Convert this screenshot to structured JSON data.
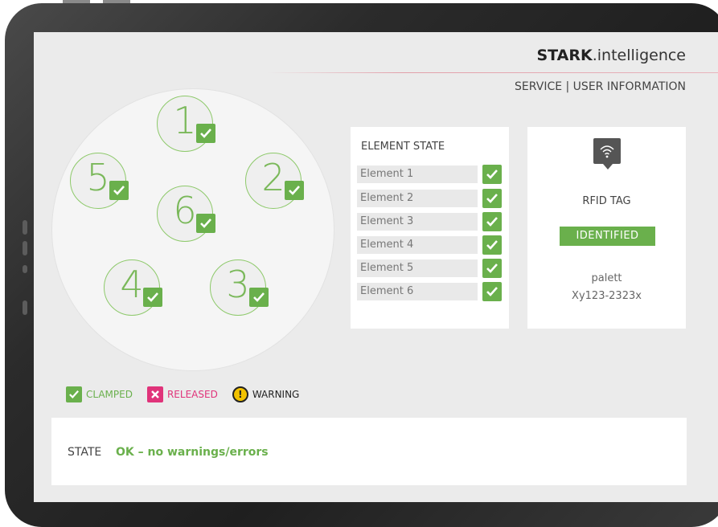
{
  "header": {
    "brand_bold": "STARK",
    "brand_light": ".intelligence",
    "nav_title": "SERVICE | USER INFORMATION"
  },
  "wheel": {
    "slots": [
      {
        "number": "1",
        "status": "clamped"
      },
      {
        "number": "2",
        "status": "clamped"
      },
      {
        "number": "3",
        "status": "clamped"
      },
      {
        "number": "4",
        "status": "clamped"
      },
      {
        "number": "5",
        "status": "clamped"
      },
      {
        "number": "6",
        "status": "clamped"
      }
    ]
  },
  "element_state": {
    "title": "ELEMENT STATE",
    "elements": [
      {
        "label": "Element 1",
        "status": "clamped"
      },
      {
        "label": "Element 2",
        "status": "clamped"
      },
      {
        "label": "Element 3",
        "status": "clamped"
      },
      {
        "label": "Element 4",
        "status": "clamped"
      },
      {
        "label": "Element 5",
        "status": "clamped"
      },
      {
        "label": "Element 6",
        "status": "clamped"
      }
    ]
  },
  "rfid": {
    "icon": "wifi-tag-icon",
    "title": "RFID TAG",
    "status": "IDENTIFIED",
    "type": "palett",
    "id": "Xy123-2323x"
  },
  "legend": {
    "clamped": "CLAMPED",
    "released": "RELEASED",
    "warning": "WARNING"
  },
  "state": {
    "label": "STATE",
    "value": "OK – no warnings/errors"
  },
  "colors": {
    "green": "#6ab04c",
    "pink": "#e0337a",
    "yellow": "#f2c200"
  }
}
